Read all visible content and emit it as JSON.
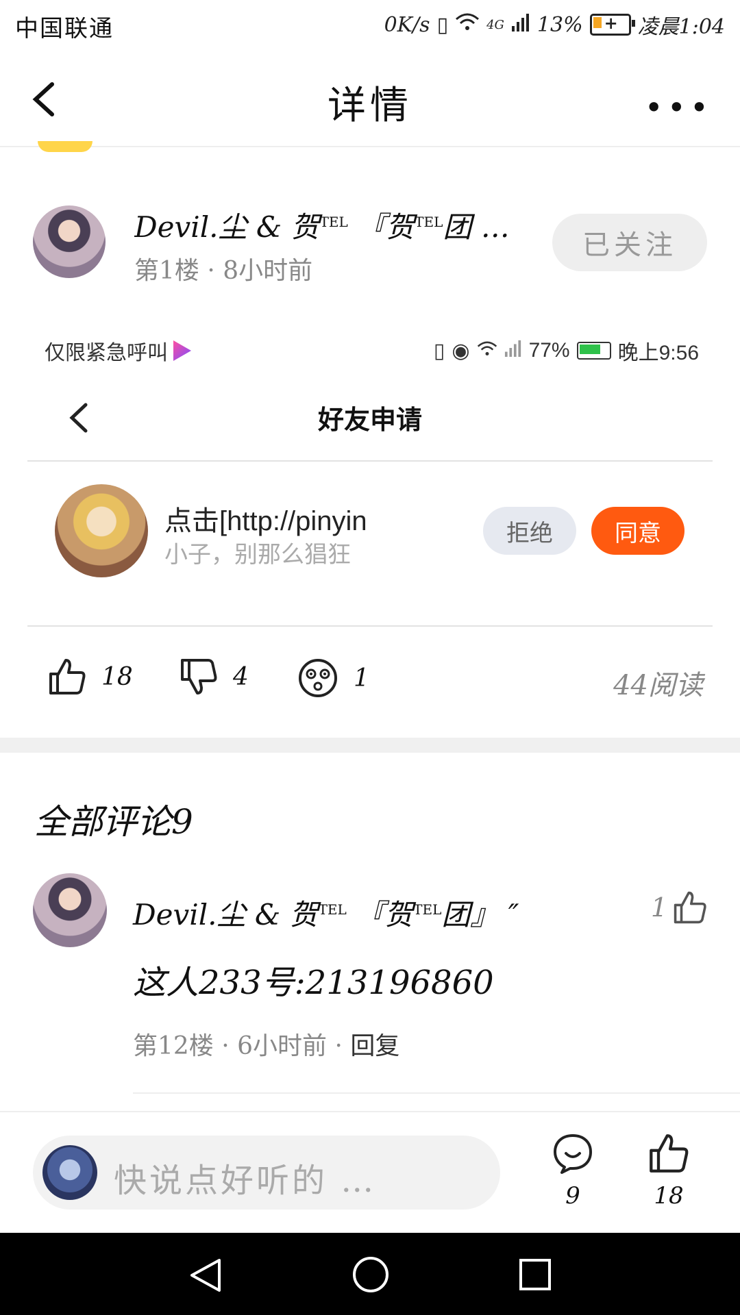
{
  "status_bar": {
    "carrier": "中国联通",
    "speed": "0K/s",
    "network": "4G",
    "battery": "13%",
    "time": "凌晨1:04"
  },
  "nav": {
    "title": "详情",
    "more": "•••"
  },
  "post": {
    "author_prefix": "Devil.尘 & 贺",
    "author_tel1": "TEL",
    "author_mid": " 『贺",
    "author_tel2": "TEL",
    "author_suffix": "团 …",
    "meta": "第1楼 · 8小时前",
    "follow_label": "已关注"
  },
  "embedded_screenshot": {
    "status_left": "仅限紧急呼叫",
    "status_battery": "77%",
    "status_time": "晚上9:56",
    "title": "好友申请",
    "requester_name": "点击[http://pinyin",
    "requester_subtitle": "小子，别那么猖狂",
    "reject_label": "拒绝",
    "accept_label": "同意"
  },
  "reactions": {
    "likes": "18",
    "dislikes": "4",
    "wows": "1",
    "reads": "44阅读"
  },
  "comments": {
    "title": "全部评论9",
    "items": [
      {
        "author_prefix": "Devil.尘 & 贺",
        "author_tel1": "TEL",
        "author_mid": " 『贺",
        "author_tel2": "TEL",
        "author_suffix": "团』 ″",
        "likes": "1",
        "text": "这人233号:213196860",
        "meta": "第12楼 · 6小时前 · ",
        "reply_label": "回复"
      }
    ]
  },
  "bottom_bar": {
    "placeholder": "快说点好听的 …",
    "comment_count": "9",
    "like_count": "18"
  },
  "colors": {
    "accent": "#ff5a10",
    "pill_bg": "#eeeeee",
    "divider": "#f0f0f0"
  }
}
